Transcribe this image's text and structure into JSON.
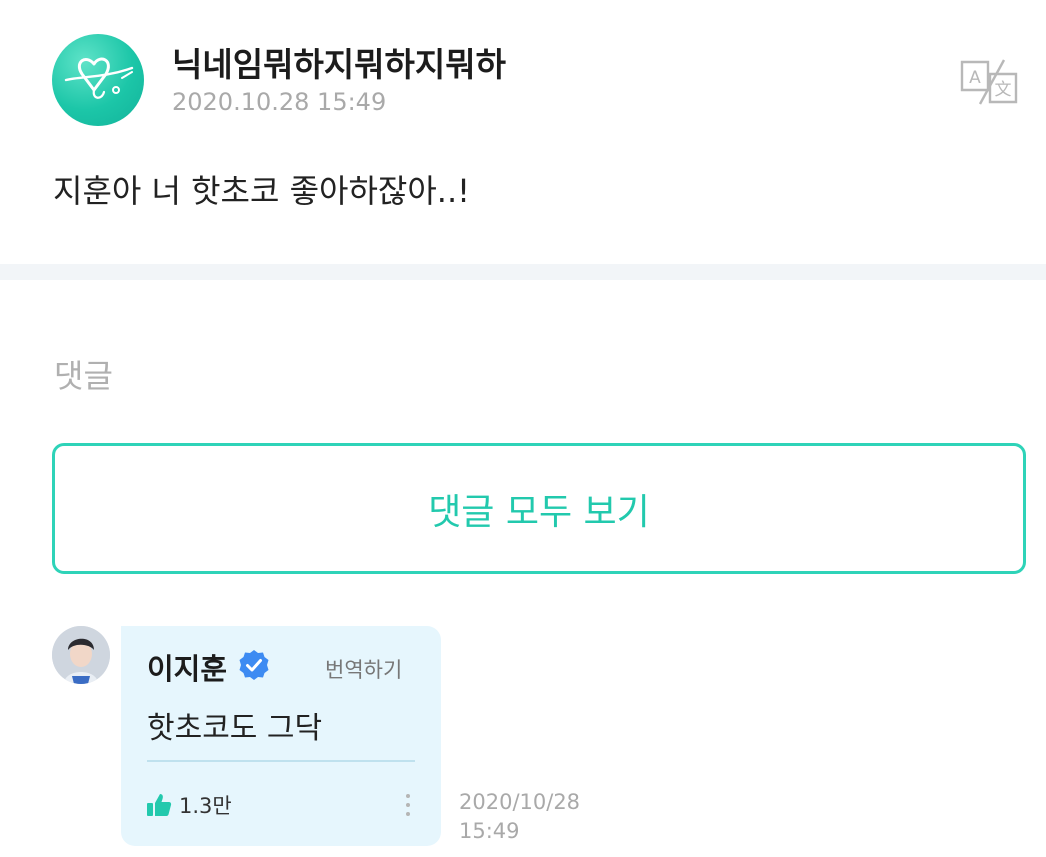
{
  "post": {
    "author_name": "닉네임뭐하지뭐하지뭐하",
    "timestamp": "2020.10.28 15:49",
    "body": "지훈아 너 핫초코 좋아하잖아..!",
    "translate_icon": "translate-icon"
  },
  "comments": {
    "title": "댓글",
    "view_all_label": "댓글 모두 보기"
  },
  "reply": {
    "author_name": "이지훈",
    "verified_icon": "verified-badge-icon",
    "translate_label": "번역하기",
    "text": "핫초코도 그닥",
    "like_icon": "thumbs-up-icon",
    "like_count": "1.3만",
    "more_icon": "more-vertical-icon",
    "date": "2020/10/28",
    "time": "15:49"
  },
  "colors": {
    "accent": "#22c9ad",
    "accent_border": "#2ed3b8",
    "reply_card_bg": "#e6f6fd",
    "verified_blue": "#3d8bf2",
    "divider_band": "#f2f5f8",
    "muted_text": "#a9a9a9"
  }
}
